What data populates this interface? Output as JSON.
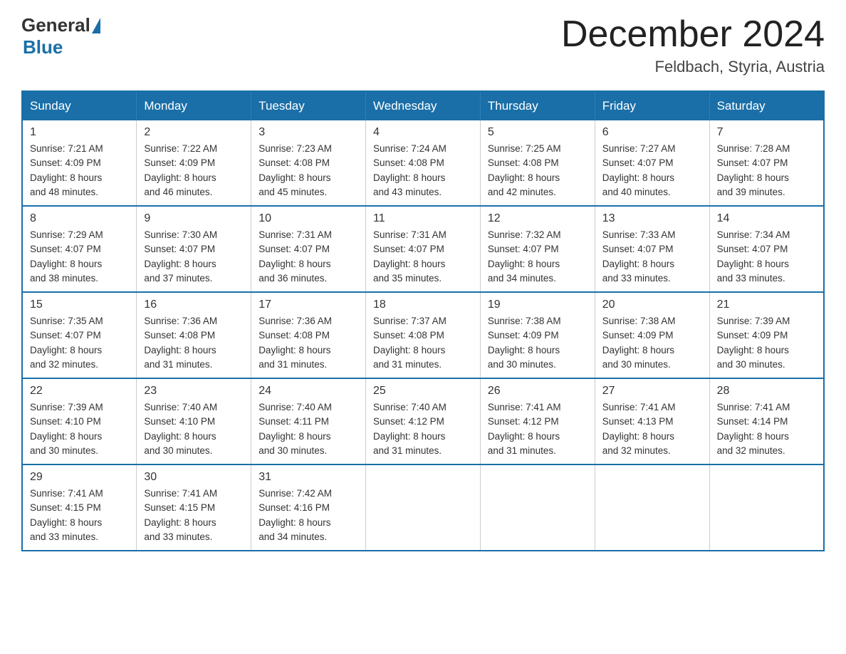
{
  "header": {
    "logo_general": "General",
    "logo_blue": "Blue",
    "month_title": "December 2024",
    "location": "Feldbach, Styria, Austria"
  },
  "weekdays": [
    "Sunday",
    "Monday",
    "Tuesday",
    "Wednesday",
    "Thursday",
    "Friday",
    "Saturday"
  ],
  "weeks": [
    [
      {
        "day": "1",
        "sunrise": "7:21 AM",
        "sunset": "4:09 PM",
        "daylight": "8 hours and 48 minutes."
      },
      {
        "day": "2",
        "sunrise": "7:22 AM",
        "sunset": "4:09 PM",
        "daylight": "8 hours and 46 minutes."
      },
      {
        "day": "3",
        "sunrise": "7:23 AM",
        "sunset": "4:08 PM",
        "daylight": "8 hours and 45 minutes."
      },
      {
        "day": "4",
        "sunrise": "7:24 AM",
        "sunset": "4:08 PM",
        "daylight": "8 hours and 43 minutes."
      },
      {
        "day": "5",
        "sunrise": "7:25 AM",
        "sunset": "4:08 PM",
        "daylight": "8 hours and 42 minutes."
      },
      {
        "day": "6",
        "sunrise": "7:27 AM",
        "sunset": "4:07 PM",
        "daylight": "8 hours and 40 minutes."
      },
      {
        "day": "7",
        "sunrise": "7:28 AM",
        "sunset": "4:07 PM",
        "daylight": "8 hours and 39 minutes."
      }
    ],
    [
      {
        "day": "8",
        "sunrise": "7:29 AM",
        "sunset": "4:07 PM",
        "daylight": "8 hours and 38 minutes."
      },
      {
        "day": "9",
        "sunrise": "7:30 AM",
        "sunset": "4:07 PM",
        "daylight": "8 hours and 37 minutes."
      },
      {
        "day": "10",
        "sunrise": "7:31 AM",
        "sunset": "4:07 PM",
        "daylight": "8 hours and 36 minutes."
      },
      {
        "day": "11",
        "sunrise": "7:31 AM",
        "sunset": "4:07 PM",
        "daylight": "8 hours and 35 minutes."
      },
      {
        "day": "12",
        "sunrise": "7:32 AM",
        "sunset": "4:07 PM",
        "daylight": "8 hours and 34 minutes."
      },
      {
        "day": "13",
        "sunrise": "7:33 AM",
        "sunset": "4:07 PM",
        "daylight": "8 hours and 33 minutes."
      },
      {
        "day": "14",
        "sunrise": "7:34 AM",
        "sunset": "4:07 PM",
        "daylight": "8 hours and 33 minutes."
      }
    ],
    [
      {
        "day": "15",
        "sunrise": "7:35 AM",
        "sunset": "4:07 PM",
        "daylight": "8 hours and 32 minutes."
      },
      {
        "day": "16",
        "sunrise": "7:36 AM",
        "sunset": "4:08 PM",
        "daylight": "8 hours and 31 minutes."
      },
      {
        "day": "17",
        "sunrise": "7:36 AM",
        "sunset": "4:08 PM",
        "daylight": "8 hours and 31 minutes."
      },
      {
        "day": "18",
        "sunrise": "7:37 AM",
        "sunset": "4:08 PM",
        "daylight": "8 hours and 31 minutes."
      },
      {
        "day": "19",
        "sunrise": "7:38 AM",
        "sunset": "4:09 PM",
        "daylight": "8 hours and 30 minutes."
      },
      {
        "day": "20",
        "sunrise": "7:38 AM",
        "sunset": "4:09 PM",
        "daylight": "8 hours and 30 minutes."
      },
      {
        "day": "21",
        "sunrise": "7:39 AM",
        "sunset": "4:09 PM",
        "daylight": "8 hours and 30 minutes."
      }
    ],
    [
      {
        "day": "22",
        "sunrise": "7:39 AM",
        "sunset": "4:10 PM",
        "daylight": "8 hours and 30 minutes."
      },
      {
        "day": "23",
        "sunrise": "7:40 AM",
        "sunset": "4:10 PM",
        "daylight": "8 hours and 30 minutes."
      },
      {
        "day": "24",
        "sunrise": "7:40 AM",
        "sunset": "4:11 PM",
        "daylight": "8 hours and 30 minutes."
      },
      {
        "day": "25",
        "sunrise": "7:40 AM",
        "sunset": "4:12 PM",
        "daylight": "8 hours and 31 minutes."
      },
      {
        "day": "26",
        "sunrise": "7:41 AM",
        "sunset": "4:12 PM",
        "daylight": "8 hours and 31 minutes."
      },
      {
        "day": "27",
        "sunrise": "7:41 AM",
        "sunset": "4:13 PM",
        "daylight": "8 hours and 32 minutes."
      },
      {
        "day": "28",
        "sunrise": "7:41 AM",
        "sunset": "4:14 PM",
        "daylight": "8 hours and 32 minutes."
      }
    ],
    [
      {
        "day": "29",
        "sunrise": "7:41 AM",
        "sunset": "4:15 PM",
        "daylight": "8 hours and 33 minutes."
      },
      {
        "day": "30",
        "sunrise": "7:41 AM",
        "sunset": "4:15 PM",
        "daylight": "8 hours and 33 minutes."
      },
      {
        "day": "31",
        "sunrise": "7:42 AM",
        "sunset": "4:16 PM",
        "daylight": "8 hours and 34 minutes."
      },
      null,
      null,
      null,
      null
    ]
  ],
  "labels": {
    "sunrise": "Sunrise:",
    "sunset": "Sunset:",
    "daylight": "Daylight:"
  }
}
